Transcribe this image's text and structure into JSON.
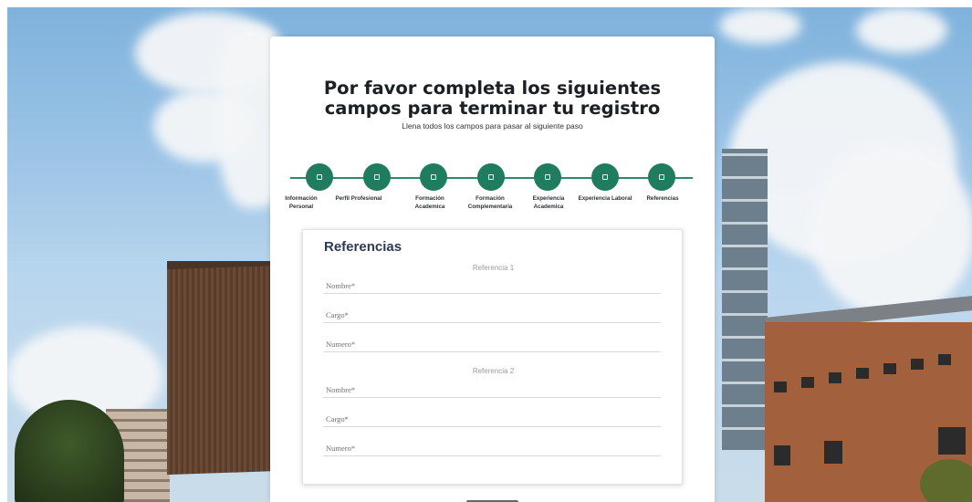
{
  "header": {
    "title": "Por favor completa los siguientes campos para terminar tu registro",
    "subtitle": "Llena todos los campos para pasar al siguiente paso"
  },
  "stepper": {
    "steps": [
      {
        "label": "Información Personal"
      },
      {
        "label": "Perfil Profesional"
      },
      {
        "label": "Formación Academica"
      },
      {
        "label": "Formación Complementaria"
      },
      {
        "label": "Experiencia Academica"
      },
      {
        "label": "Experiencia Laboral"
      },
      {
        "label": "Referencias"
      }
    ],
    "active_color": "#1f7c5f"
  },
  "form": {
    "title": "Referencias",
    "references": [
      {
        "heading": "Referencia 1",
        "fields": [
          {
            "placeholder": "Nombre*",
            "value": ""
          },
          {
            "placeholder": "Cargo*",
            "value": ""
          },
          {
            "placeholder": "Numero*",
            "value": ""
          }
        ]
      },
      {
        "heading": "Referencia 2",
        "fields": [
          {
            "placeholder": "Nombre*",
            "value": ""
          },
          {
            "placeholder": "Cargo*",
            "value": ""
          },
          {
            "placeholder": "Numero*",
            "value": ""
          }
        ]
      }
    ]
  }
}
